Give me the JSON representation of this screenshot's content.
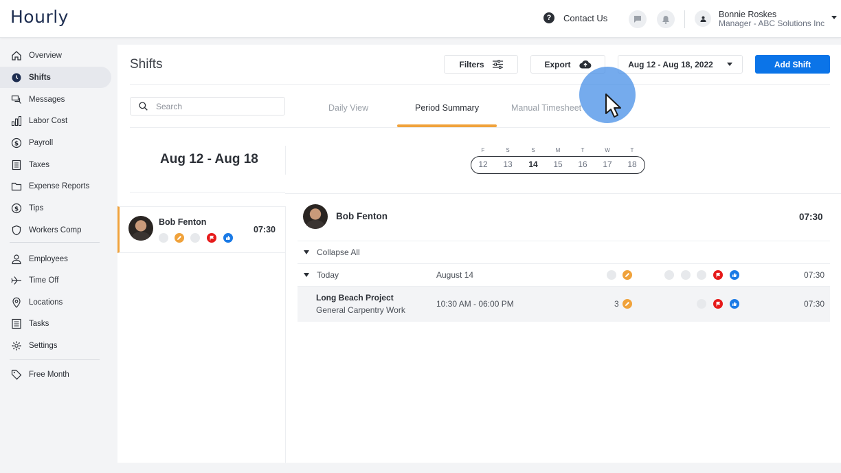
{
  "app": {
    "logo": "Hourly"
  },
  "header": {
    "contact_label": "Contact Us",
    "user_name": "Bonnie Roskes",
    "user_role": "Manager - ABC Solutions Inc"
  },
  "sidebar": {
    "items": [
      {
        "label": "Overview",
        "icon": "home-icon"
      },
      {
        "label": "Shifts",
        "icon": "clock-icon",
        "active": true
      },
      {
        "label": "Messages",
        "icon": "messages-icon"
      },
      {
        "label": "Labor Cost",
        "icon": "bar-chart-icon"
      },
      {
        "label": "Payroll",
        "icon": "dollar-circle-icon"
      },
      {
        "label": "Taxes",
        "icon": "document-icon"
      },
      {
        "label": "Expense Reports",
        "icon": "folder-icon"
      },
      {
        "label": "Tips",
        "icon": "dollar-circle-icon"
      },
      {
        "label": "Workers Comp",
        "icon": "shield-icon"
      },
      {
        "label": "Employees",
        "icon": "person-icon"
      },
      {
        "label": "Time Off",
        "icon": "plane-icon"
      },
      {
        "label": "Locations",
        "icon": "location-pin-icon"
      },
      {
        "label": "Tasks",
        "icon": "list-icon"
      },
      {
        "label": "Settings",
        "icon": "gear-icon"
      },
      {
        "label": "Free Month",
        "icon": "tag-icon"
      }
    ]
  },
  "toolbar": {
    "title": "Shifts",
    "filters_label": "Filters",
    "export_label": "Export",
    "date_range": "Aug 12 - Aug 18, 2022",
    "add_shift_label": "Add Shift"
  },
  "search": {
    "placeholder": "Search"
  },
  "tabs": [
    {
      "label": "Daily View",
      "active": false
    },
    {
      "label": "Period Summary",
      "active": true
    },
    {
      "label": "Manual Timesheet",
      "active": false
    }
  ],
  "period": {
    "label": "Aug 12 - Aug 18"
  },
  "week": {
    "letters": [
      "F",
      "S",
      "S",
      "M",
      "T",
      "W",
      "T"
    ],
    "days": [
      "12",
      "13",
      "14",
      "15",
      "16",
      "17",
      "18"
    ],
    "selected_index": 2
  },
  "employee_list": [
    {
      "name": "Bob Fenton",
      "hours": "07:30"
    }
  ],
  "detail": {
    "employee_name": "Bob Fenton",
    "total_hours": "07:30",
    "collapse_all_label": "Collapse All",
    "day": {
      "label": "Today",
      "date": "August 14",
      "hours": "07:30"
    },
    "shift": {
      "project": "Long Beach Project",
      "task": "General Carpentry Work",
      "time_range": "10:30 AM - 06:00 PM",
      "edit_count": "3",
      "hours": "07:30"
    }
  },
  "colors": {
    "primary": "#0b74e8",
    "accent": "#f0a23b",
    "flag_red": "#e61a1a",
    "approve_blue": "#1a7ae6"
  }
}
